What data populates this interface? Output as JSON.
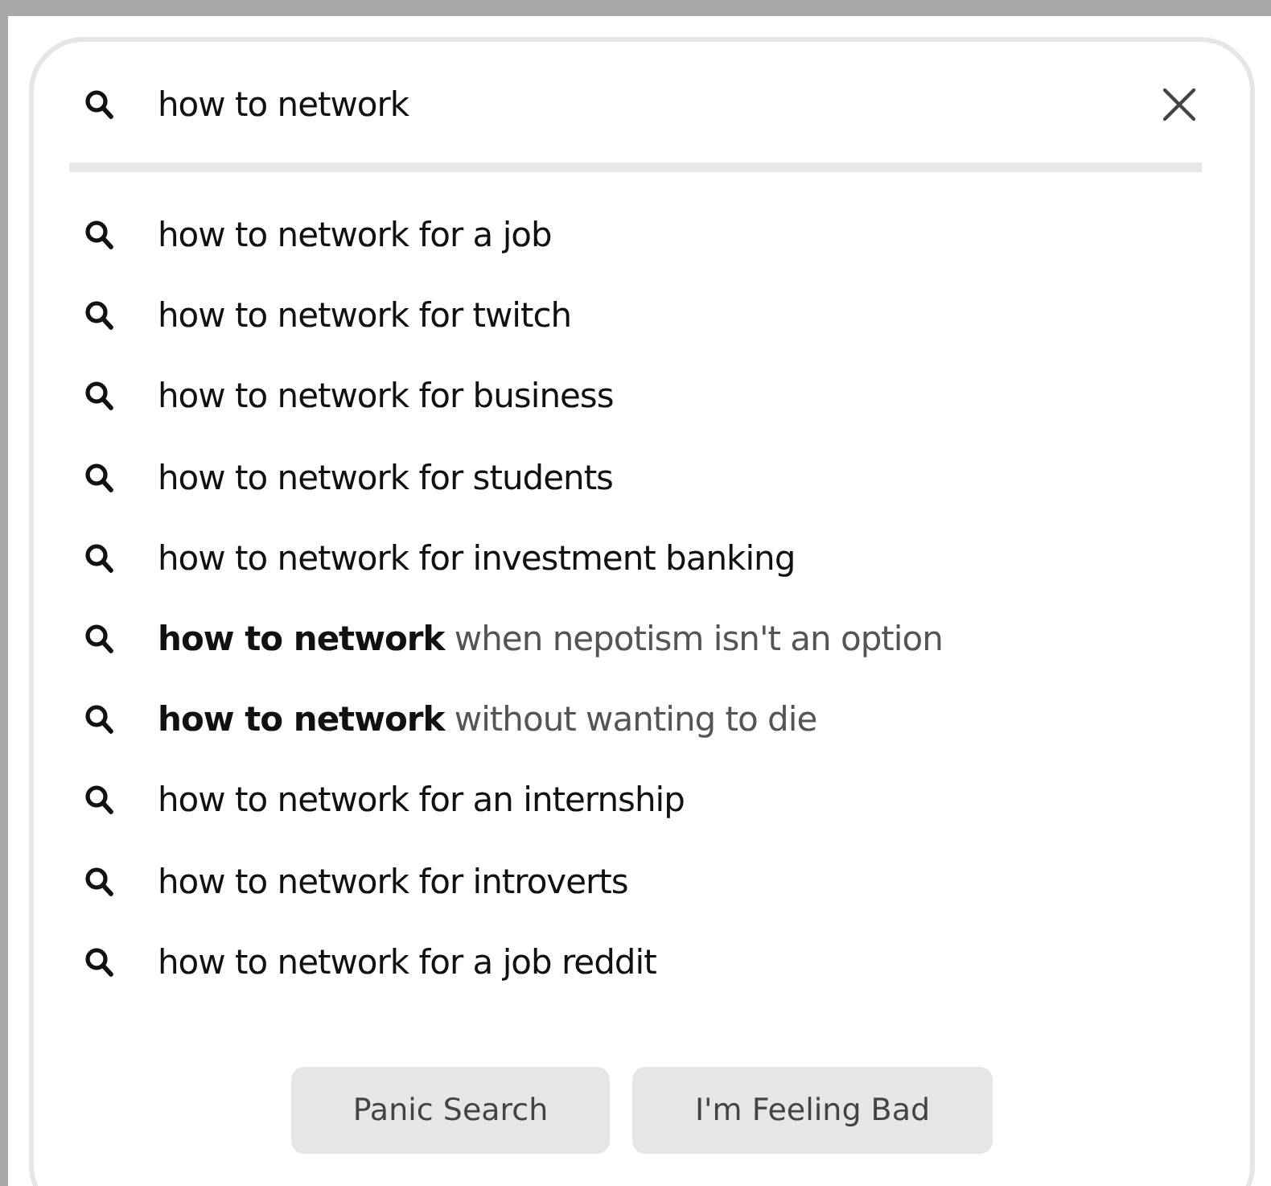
{
  "search": {
    "value": "how to network"
  },
  "suggestions": [
    {
      "text": "how to network for a job",
      "muted": false
    },
    {
      "text": "how to network for twitch",
      "muted": false
    },
    {
      "text": "how to network for business",
      "muted": false
    },
    {
      "text": "how to network for students",
      "muted": false
    },
    {
      "text": "how to network for investment banking",
      "muted": false
    },
    {
      "text": "**how to network** when nepotism isn't an option",
      "muted": true
    },
    {
      "text": "**how to network** without wanting to die",
      "muted": true
    },
    {
      "text": "how to network for an internship",
      "muted": false
    },
    {
      "text": "how to network for introverts",
      "muted": false
    },
    {
      "text": "how to network for a job reddit",
      "muted": false
    }
  ],
  "buttons": [
    "Panic Search",
    "I'm Feeling Bad"
  ]
}
